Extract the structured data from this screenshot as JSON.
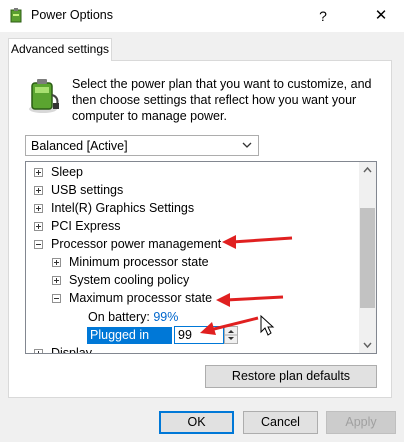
{
  "window": {
    "title": "Power Options",
    "help_glyph": "?",
    "close_glyph": "✕"
  },
  "tabs": [
    {
      "label": "Advanced settings"
    }
  ],
  "intro_text": "Select the power plan that you want to customize, and then choose settings that reflect how you want your computer to manage power.",
  "plan_dropdown": {
    "selected": "Balanced [Active]"
  },
  "settings_tree": {
    "items": [
      {
        "label": "Sleep",
        "expander": "plus"
      },
      {
        "label": "USB settings",
        "expander": "plus"
      },
      {
        "label": "Intel(R) Graphics Settings",
        "expander": "plus"
      },
      {
        "label": "PCI Express",
        "expander": "plus"
      },
      {
        "label": "Processor power management",
        "expander": "minus"
      },
      {
        "label": "Minimum processor state",
        "expander": "plus"
      },
      {
        "label": "System cooling policy",
        "expander": "plus"
      },
      {
        "label": "Maximum processor state",
        "expander": "minus"
      },
      {
        "label": "Display",
        "expander": "plus"
      }
    ],
    "on_battery": {
      "label": "On battery:",
      "value": "99%"
    },
    "plugged_in": {
      "label": "Plugged in (%):",
      "value": "99"
    }
  },
  "restore_button": "Restore plan defaults",
  "footer": {
    "ok": "OK",
    "cancel": "Cancel",
    "apply": "Apply"
  },
  "annotation_arrow_color": "#e02020",
  "selection_color": "#0078d7"
}
